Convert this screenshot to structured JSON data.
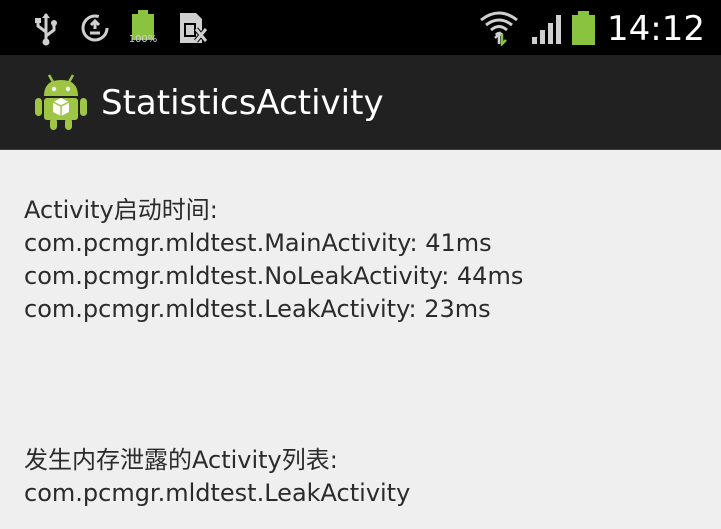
{
  "status_bar": {
    "time": "14:12",
    "icons": [
      "usb-icon",
      "sync-icon",
      "battery-full-icon",
      "sim-card-icon",
      "wifi-icon",
      "signal-icon",
      "battery-icon"
    ],
    "battery_label": "100%",
    "colors": {
      "background": "#000000",
      "battery_green": "#8ac33f",
      "icon": "#d0d0d0"
    }
  },
  "action_bar": {
    "title": "StatisticsActivity",
    "icon": "android-robot-icon",
    "colors": {
      "background": "#212121",
      "android_green": "#9fc545"
    }
  },
  "content": {
    "startup_section": {
      "header": "Activity启动时间:",
      "entries": [
        "com.pcmgr.mldtest.MainActivity: 41ms",
        "com.pcmgr.mldtest.NoLeakActivity: 44ms",
        "com.pcmgr.mldtest.LeakActivity: 23ms"
      ]
    },
    "leak_section": {
      "header": "发生内存泄露的Activity列表:",
      "entries": [
        "com.pcmgr.mldtest.LeakActivity"
      ]
    },
    "colors": {
      "background": "#efefef",
      "text": "#2b2b2b"
    }
  }
}
